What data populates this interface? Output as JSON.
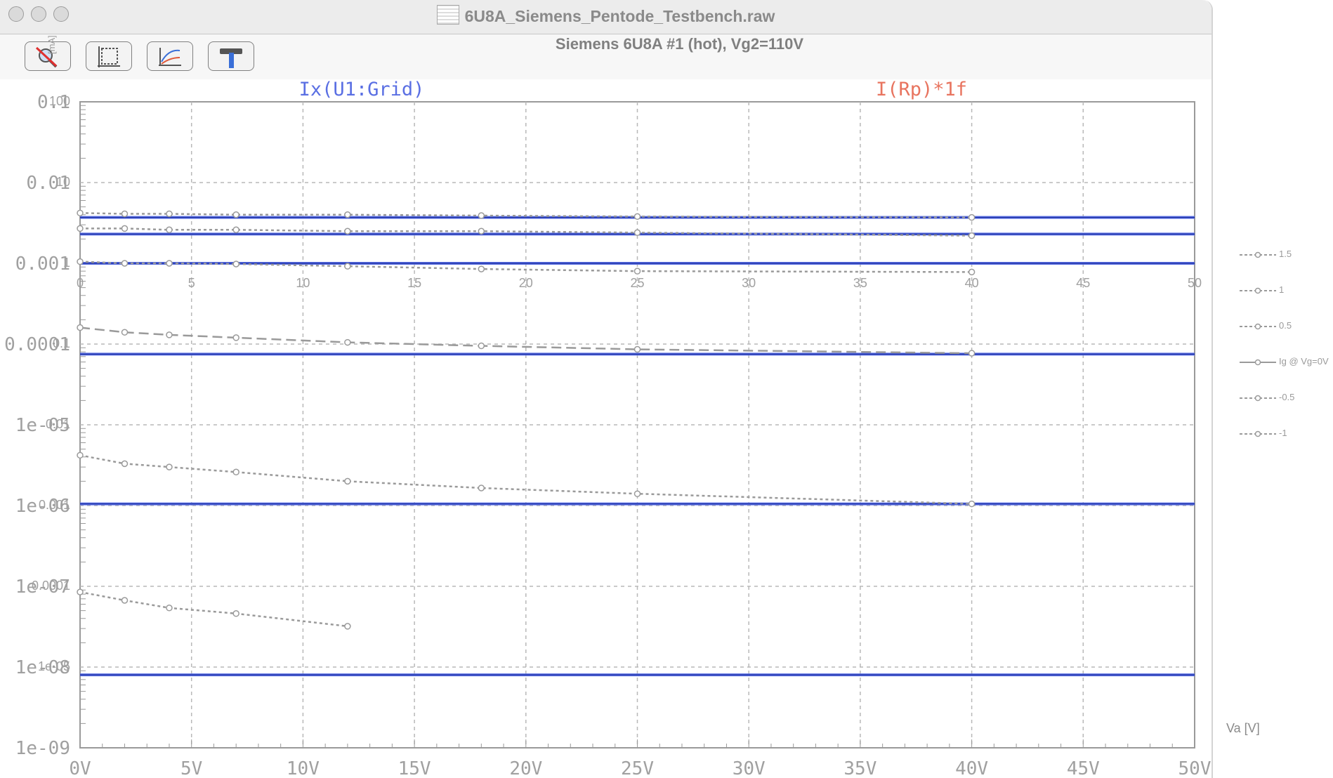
{
  "window": {
    "title": "6U8A_Siemens_Pentode_Testbench.raw"
  },
  "toolbar": {
    "buttons": [
      {
        "name": "autoscale-off-button",
        "icon": "zoom-cancel-icon"
      },
      {
        "name": "fit-axes-button",
        "icon": "axes-fit-icon"
      },
      {
        "name": "plot-settings-button",
        "icon": "plot-curve-icon"
      },
      {
        "name": "tools-button",
        "icon": "hammer-icon"
      }
    ],
    "y_unit_label": "[mA]"
  },
  "colors": {
    "sim_trace": "#5a6fe3",
    "sim_trace_dark": "#0c1f8f",
    "measured": "#9a9a9a",
    "rp_label": "#e8745f",
    "grid_label": "#5a6fe3",
    "grid": "#b8b8b8",
    "tick_text": "#a0a0a0"
  },
  "chart_data": {
    "type": "line",
    "title": "Siemens 6U8A #1 (hot), Vg2=110V",
    "trace_labels": {
      "left": "Ix(U1:Grid)",
      "right": "I(Rp)*1f"
    },
    "x_axis": {
      "label": "Va [V]",
      "ticks": [
        "0V",
        "5V",
        "10V",
        "15V",
        "20V",
        "25V",
        "30V",
        "35V",
        "40V",
        "45V",
        "50V"
      ],
      "inner_ticks": [
        "0",
        "5",
        "10",
        "15",
        "20",
        "25",
        "30",
        "35",
        "40",
        "45",
        "50"
      ],
      "range": [
        0,
        50
      ]
    },
    "y_axis": {
      "scale": "log",
      "range": [
        1e-09,
        0.1
      ],
      "ticks_left": [
        "0.1",
        "0.01",
        "0.001",
        "0.0001",
        "1e-05",
        "1e-06",
        "1e-07",
        "1e-08",
        "1e-09"
      ],
      "ticks_overlay": [
        "100",
        "10",
        "1",
        "0.1",
        "0.01",
        "0.001",
        "0.0001",
        "1e-05"
      ]
    },
    "series": [
      {
        "name": "1.5",
        "kind": "measured",
        "x": [
          0,
          2,
          4,
          7,
          12,
          18,
          25,
          40
        ],
        "y": [
          0.0042,
          0.0041,
          0.0041,
          0.004,
          0.004,
          0.0039,
          0.0038,
          0.0037
        ]
      },
      {
        "name": "1",
        "kind": "measured",
        "x": [
          0,
          2,
          4,
          7,
          12,
          18,
          25,
          40
        ],
        "y": [
          0.0027,
          0.0027,
          0.0026,
          0.0026,
          0.0025,
          0.0025,
          0.0024,
          0.0022
        ]
      },
      {
        "name": "0.5",
        "kind": "measured",
        "x": [
          0,
          2,
          4,
          7,
          12,
          18,
          25,
          40
        ],
        "y": [
          0.00105,
          0.001,
          0.001,
          0.00098,
          0.00092,
          0.00085,
          0.0008,
          0.00078
        ]
      },
      {
        "name": "Ig @ Vg=0V",
        "kind": "measured",
        "x": [
          0,
          2,
          4,
          7,
          12,
          18,
          25,
          40
        ],
        "y": [
          0.00016,
          0.00014,
          0.00013,
          0.00012,
          0.000105,
          9.5e-05,
          8.6e-05,
          7.7e-05
        ]
      },
      {
        "name": "-0.5",
        "kind": "measured",
        "x": [
          0,
          2,
          4,
          7,
          12,
          18,
          25,
          40
        ],
        "y": [
          4.2e-06,
          3.3e-06,
          3e-06,
          2.6e-06,
          2e-06,
          1.65e-06,
          1.4e-06,
          1.05e-06
        ]
      },
      {
        "name": "-1",
        "kind": "measured",
        "x": [
          0,
          2,
          4,
          7,
          12
        ],
        "y": [
          8.5e-08,
          6.7e-08,
          5.4e-08,
          4.6e-08,
          3.2e-08
        ]
      },
      {
        "kind": "simulated",
        "x": [
          0,
          50
        ],
        "y": [
          0.0037,
          0.0037
        ]
      },
      {
        "kind": "simulated",
        "x": [
          0,
          50
        ],
        "y": [
          0.0023,
          0.0023
        ]
      },
      {
        "kind": "simulated",
        "x": [
          0,
          50
        ],
        "y": [
          0.001,
          0.001
        ]
      },
      {
        "kind": "simulated",
        "x": [
          0,
          50
        ],
        "y": [
          7.5e-05,
          7.5e-05
        ]
      },
      {
        "kind": "simulated",
        "x": [
          0,
          50
        ],
        "y": [
          1.05e-06,
          1.05e-06
        ]
      },
      {
        "kind": "simulated",
        "x": [
          0,
          50
        ],
        "y": [
          8e-09,
          8e-09
        ]
      }
    ],
    "legend_position": "right",
    "grid": true
  }
}
